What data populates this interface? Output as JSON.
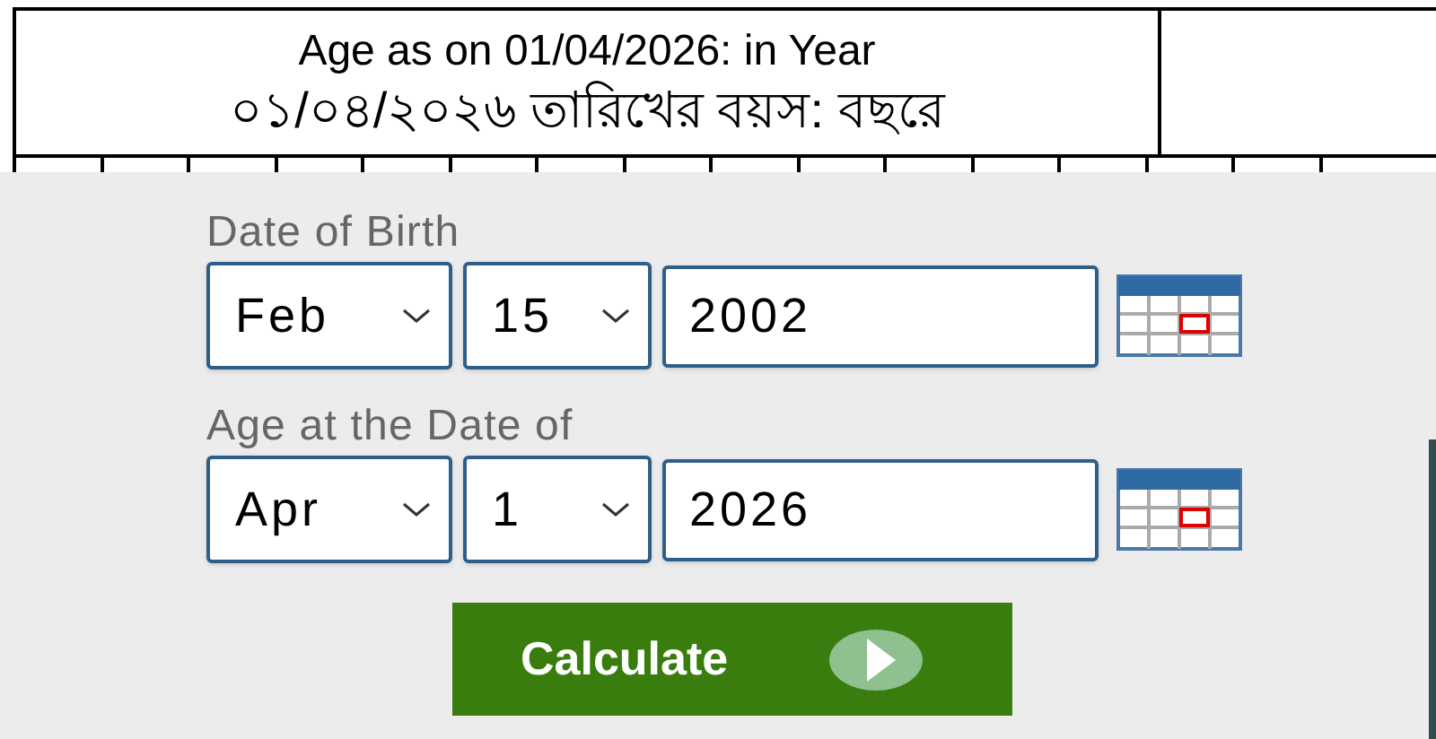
{
  "header": {
    "title_en": "Age as on 01/04/2026: in Year",
    "title_bn": "০১/০৪/২০২৬ তারিখের বয়স: বছরে"
  },
  "date_rows": [
    {
      "label": "Date of Birth",
      "month": "Feb",
      "day": "15",
      "year": "2002"
    },
    {
      "label": "Age at the Date of",
      "month": "Apr",
      "day": "1",
      "year": "2026"
    }
  ],
  "button": {
    "label": "Calculate"
  }
}
